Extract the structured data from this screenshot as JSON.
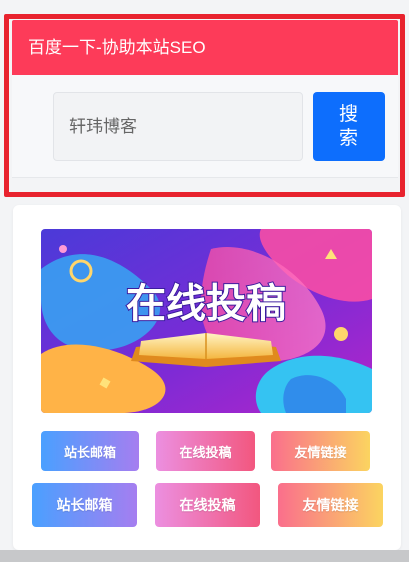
{
  "seo": {
    "header_title": "百度一下-协助本站SEO",
    "search_placeholder": "轩玮博客",
    "search_button_label": "搜索"
  },
  "banner": {
    "text": "在线投稿"
  },
  "links_row1": [
    {
      "label": "站长邮箱"
    },
    {
      "label": "在线投稿"
    },
    {
      "label": "友情链接"
    }
  ],
  "links_row2": [
    {
      "label": "站长邮箱"
    },
    {
      "label": "在线投稿"
    },
    {
      "label": "友情链接"
    }
  ],
  "colors": {
    "header_red": "#fd3b59",
    "highlight_frame": "#e8232e",
    "search_button_blue": "#0d6efd"
  }
}
